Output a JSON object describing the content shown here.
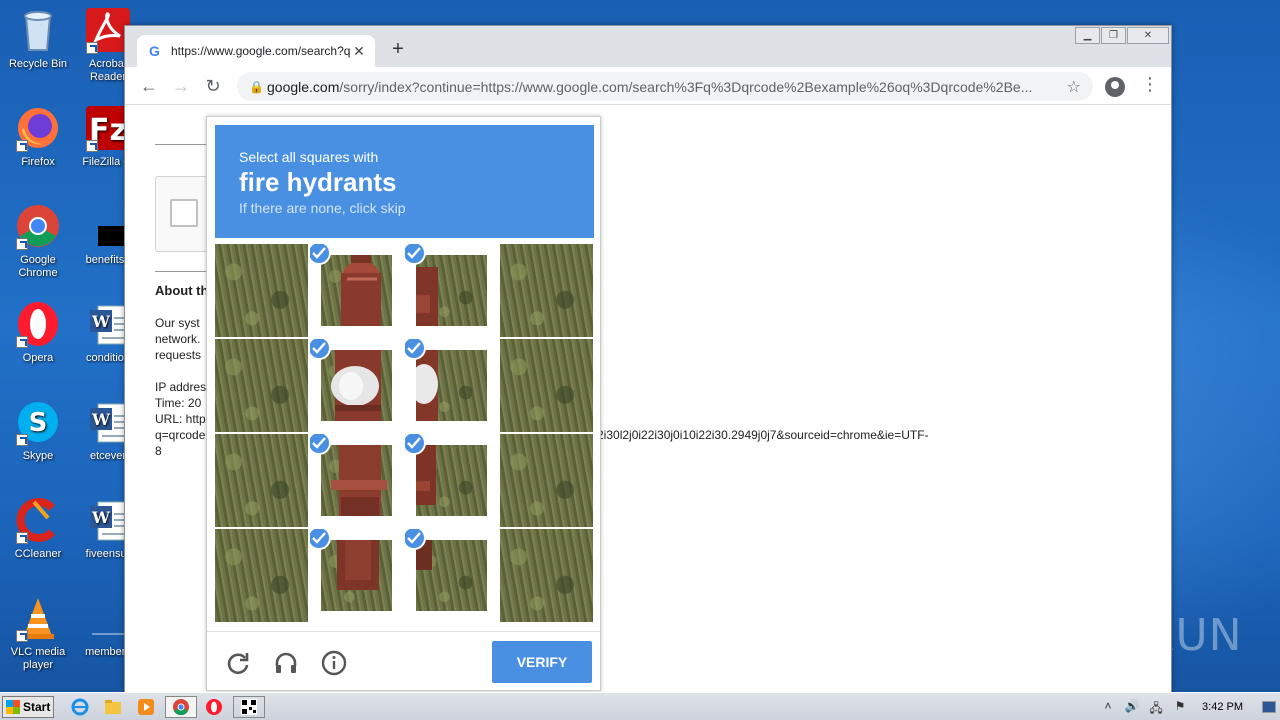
{
  "desktop": {
    "icons": [
      {
        "label": "Recycle Bin",
        "icon": "recycle-bin-icon"
      },
      {
        "label": "Acrobat Reader",
        "icon": "acrobat-icon"
      },
      {
        "label": "Firefox",
        "icon": "firefox-icon"
      },
      {
        "label": "FileZilla Cl",
        "icon": "filezilla-icon"
      },
      {
        "label": "Google Chrome",
        "icon": "chrome-icon"
      },
      {
        "label": "benefitsn",
        "icon": "file-icon"
      },
      {
        "label": "Opera",
        "icon": "opera-icon"
      },
      {
        "label": "condition",
        "icon": "word-doc-icon"
      },
      {
        "label": "Skype",
        "icon": "skype-icon"
      },
      {
        "label": "etcever",
        "icon": "word-doc-icon"
      },
      {
        "label": "CCleaner",
        "icon": "ccleaner-icon"
      },
      {
        "label": "fiveensur",
        "icon": "word-doc-icon"
      },
      {
        "label": "VLC media player",
        "icon": "vlc-icon"
      },
      {
        "label": "members",
        "icon": "file-icon"
      }
    ]
  },
  "browser": {
    "tab_title": "https://www.google.com/search?q=",
    "new_tab": "+",
    "address": {
      "host": "google.com",
      "path": "/sorry/index?continue=https://www.google.com/search%3Fq%3Dqrcode%2Bexample%26oq%3Dqrcode%2Be..."
    }
  },
  "page": {
    "about_heading": "About th",
    "para1": [
      "Our syst",
      "network.",
      "requests"
    ],
    "ip_line": "IP addres",
    "time_line": "Time: 20",
    "url_line": "URL: http",
    "q_line": "q=qrcode",
    "url_tail": "2i30l2j0i22i30j0i10i22i30.2949j0j7&sourceid=chrome&ie=UTF-",
    "last_line": "8"
  },
  "captcha": {
    "instruction": "Select all squares with",
    "target": "fire hydrants",
    "hint": "If there are none, click skip",
    "verify_label": "VERIFY",
    "tiles_selected": [
      false,
      true,
      true,
      false,
      false,
      true,
      true,
      false,
      false,
      true,
      true,
      false,
      false,
      true,
      true,
      false
    ],
    "accent_color": "#4a90e2"
  },
  "taskbar": {
    "start_label": "Start",
    "clock": "3:42 PM"
  },
  "watermark": "ANY RUN"
}
